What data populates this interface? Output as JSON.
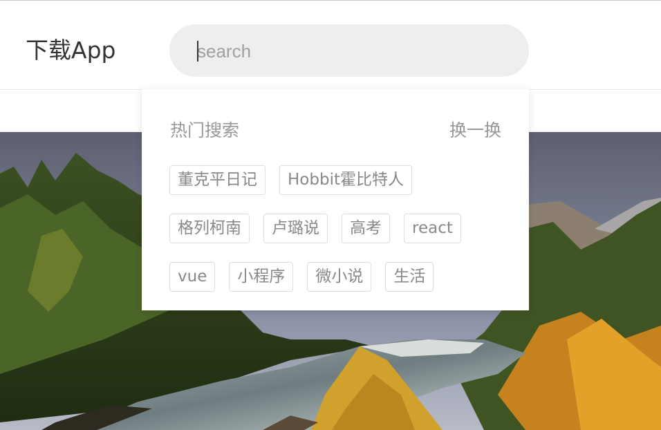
{
  "header": {
    "download_app": "下载App",
    "search": {
      "placeholder": "search",
      "value": ""
    }
  },
  "hot_search": {
    "title": "热门搜索",
    "switch_label": "换一换",
    "rows": [
      [
        "董克平日记",
        "Hobbit霍比特人"
      ],
      [
        "格列柯南",
        "卢璐说",
        "高考",
        "react"
      ],
      [
        "vue",
        "小程序",
        "微小说",
        "生活"
      ]
    ]
  },
  "colors": {
    "search_bg": "#eeeeee",
    "tag_border": "#dddddd",
    "muted_text": "#999999"
  }
}
